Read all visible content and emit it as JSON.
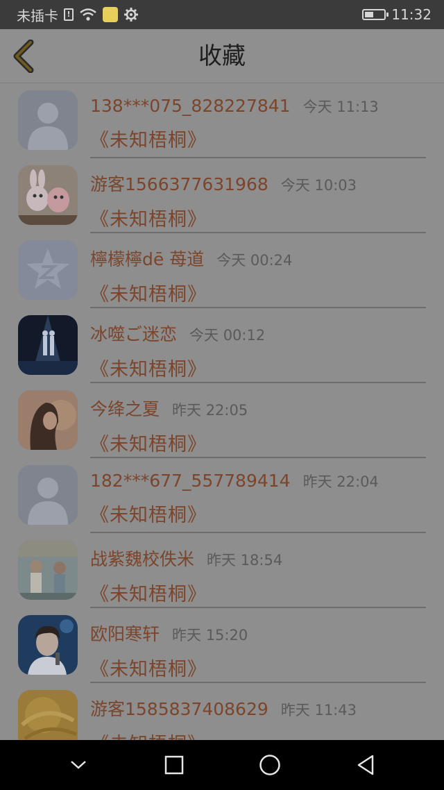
{
  "status_bar": {
    "carrier": "未插卡",
    "time": "11:32",
    "battery_level": 0.45,
    "icons": [
      "sim-alert-icon",
      "wifi-icon",
      "app-notification-icon",
      "gear-icon",
      "battery-icon"
    ]
  },
  "header": {
    "title": "收藏",
    "back_icon": "chevron-left-icon"
  },
  "colors": {
    "username": "#7b452c",
    "time": "#5a5a5a",
    "title": "#1e1e1e",
    "back_accent": "#6f5a1f"
  },
  "favorites": [
    {
      "username": "138***075_828227841",
      "time": "今天  11:13",
      "work": "《未知梧桐》",
      "avatar": "default-avatar"
    },
    {
      "username": "游客1566377631968",
      "time": "今天  10:03",
      "work": "《未知梧桐》",
      "avatar": "plush-toys-avatar"
    },
    {
      "username": "檸檬檸dē 苺道",
      "time": "今天  00:24",
      "work": "《未知梧桐》",
      "avatar": "qzone-star-avatar"
    },
    {
      "username": "冰噬ご迷恋",
      "time": "今天  00:12",
      "work": "《未知梧桐》",
      "avatar": "stage-avatar"
    },
    {
      "username": "今绛之夏",
      "time": "昨天  22:05",
      "work": "《未知梧桐》",
      "avatar": "girl-portrait-avatar"
    },
    {
      "username": "182***677_557789414",
      "time": "昨天  22:04",
      "work": "《未知梧桐》",
      "avatar": "default-avatar"
    },
    {
      "username": "战紫魏校佚米",
      "time": "昨天  18:54",
      "work": "《未知梧桐》",
      "avatar": "drama-scene-avatar"
    },
    {
      "username": "欧阳寒轩",
      "time": "昨天  15:20",
      "work": "《未知梧桐》",
      "avatar": "singer-avatar"
    },
    {
      "username": "游客1585837408629",
      "time": "昨天  11:43",
      "work": "《未知梧桐》",
      "avatar": "yellow-abstract-avatar"
    }
  ],
  "nav_bar": {
    "icons": [
      "hide-keyboard-icon",
      "recents-square-icon",
      "home-circle-icon",
      "back-triangle-icon"
    ]
  }
}
